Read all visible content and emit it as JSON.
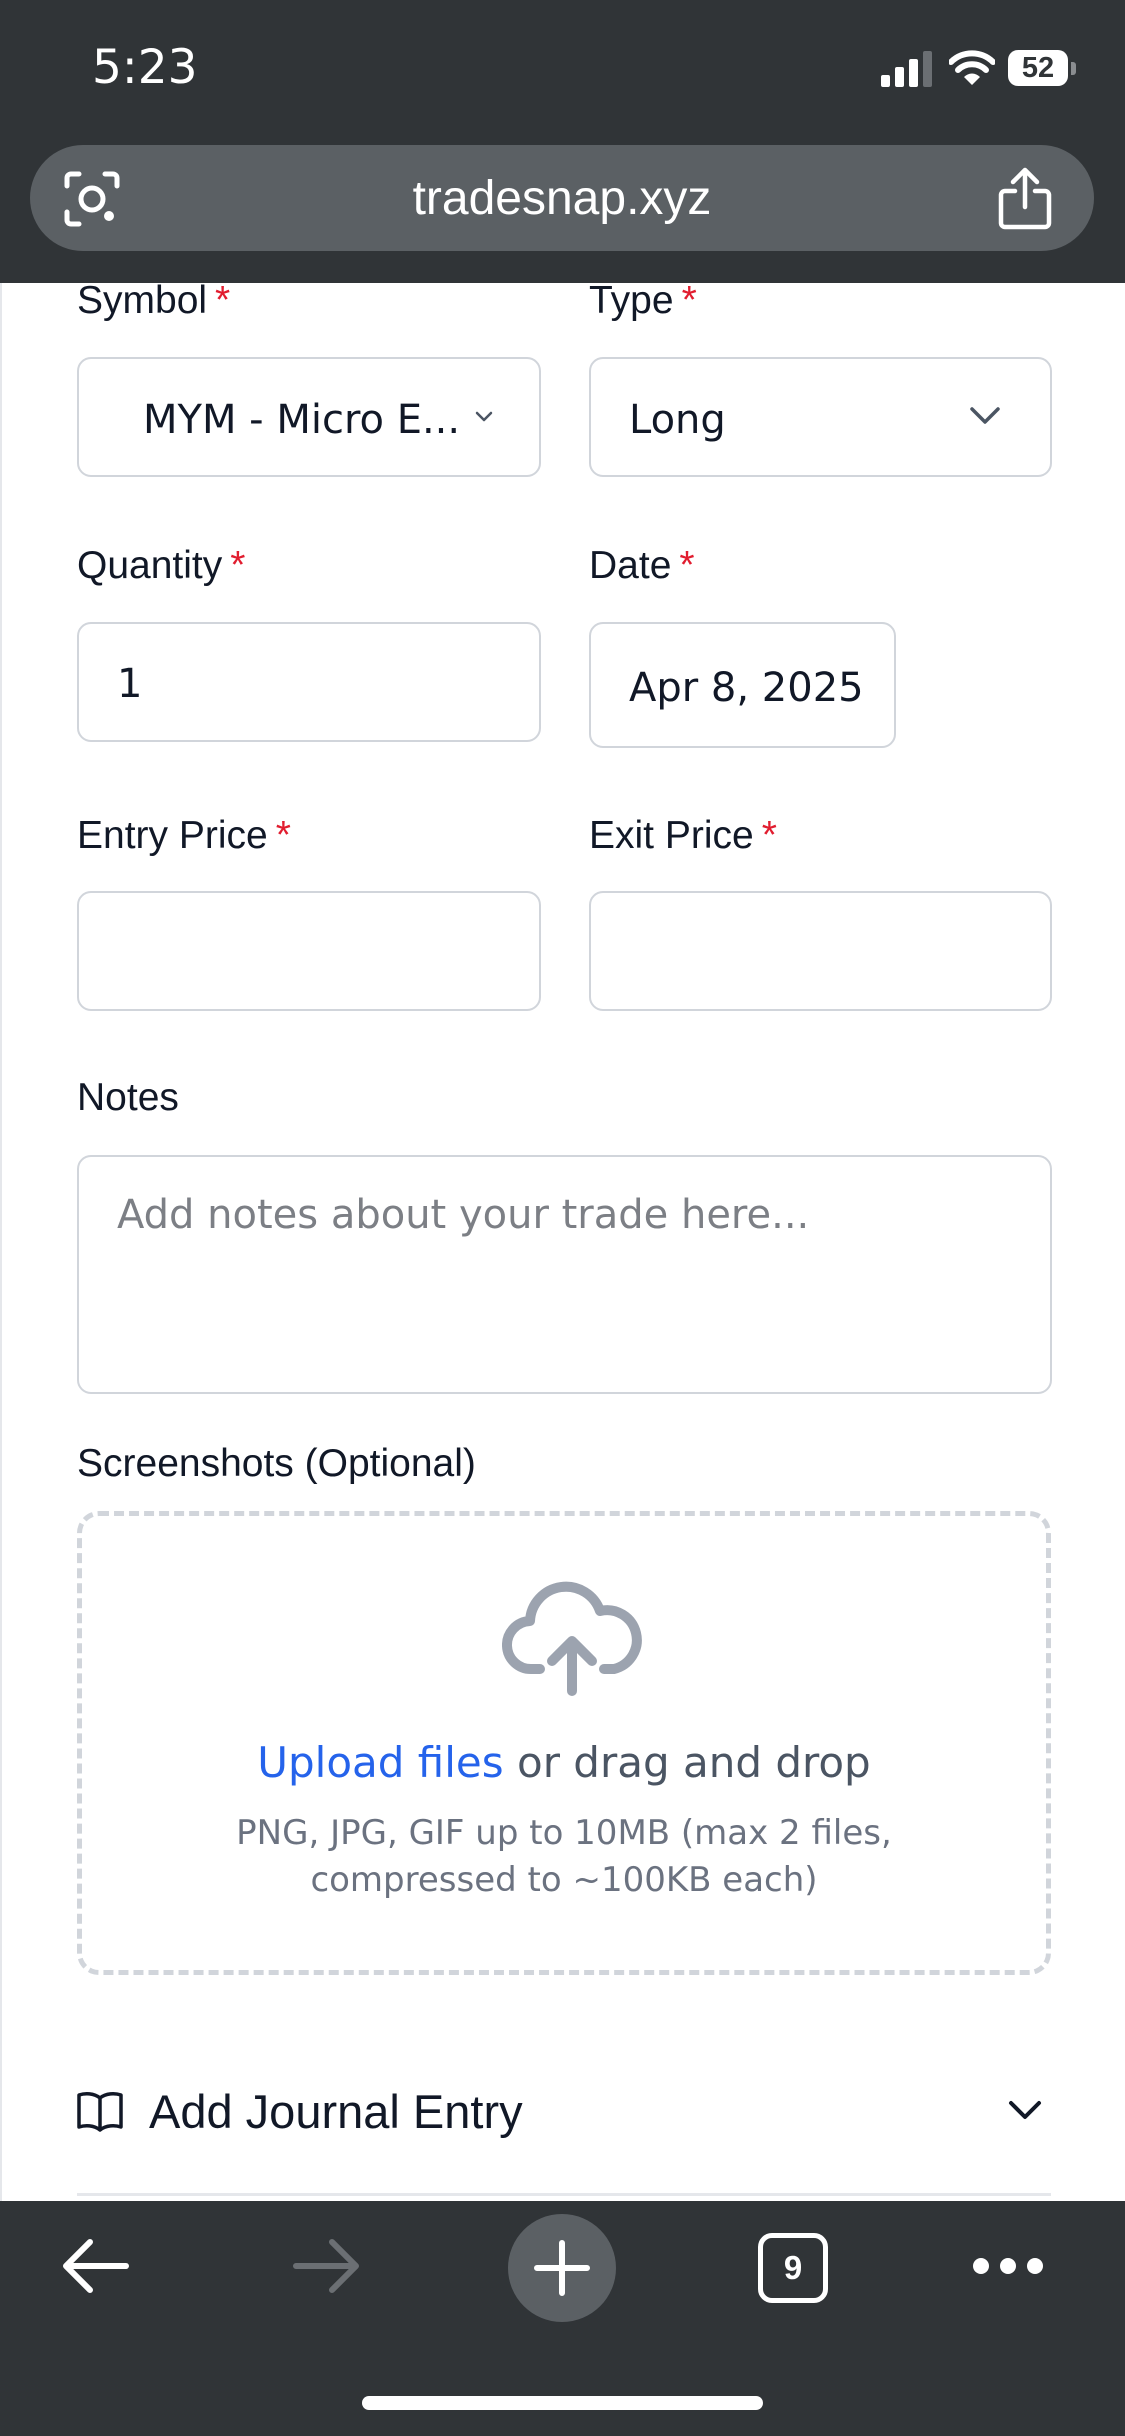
{
  "status_bar": {
    "time": "5:23",
    "battery": "52"
  },
  "browser": {
    "url": "tradesnap.xyz",
    "tab_count": "9"
  },
  "form": {
    "symbol": {
      "label": "Symbol",
      "required": "*",
      "value": "MYM - Micro E..."
    },
    "type": {
      "label": "Type",
      "required": "*",
      "value": "Long"
    },
    "quantity": {
      "label": "Quantity",
      "required": "*",
      "value": "1"
    },
    "date": {
      "label": "Date",
      "required": "*",
      "value": "Apr 8, 2025"
    },
    "entry_price": {
      "label": "Entry Price",
      "required": "*",
      "value": ""
    },
    "exit_price": {
      "label": "Exit Price",
      "required": "*",
      "value": ""
    },
    "notes": {
      "label": "Notes",
      "placeholder": "Add notes about your trade here..."
    },
    "screenshots": {
      "label": "Screenshots (Optional)",
      "upload_link": "Upload files",
      "upload_rest": " or drag and drop",
      "hint_line1": "PNG, JPG, GIF up to 10MB (max 2 files,",
      "hint_line2": "compressed to ~100KB each)"
    },
    "journal": {
      "label": "Add Journal Entry"
    }
  },
  "colors": {
    "accent": "#2563eb",
    "required": "#e11d2f",
    "chrome": "#303437"
  }
}
